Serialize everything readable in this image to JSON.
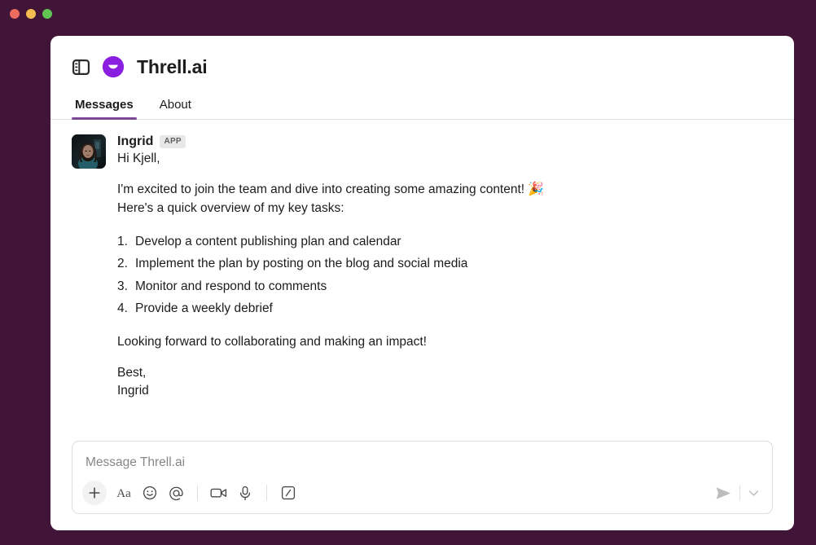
{
  "window": {
    "background_color": "#411538",
    "traffic_lights": [
      {
        "name": "close",
        "color": "#EC6A5E"
      },
      {
        "name": "minimize",
        "color": "#F4BD4F"
      },
      {
        "name": "maximize",
        "color": "#61C554"
      }
    ]
  },
  "header": {
    "sidebar_toggle_icon": "sidebar-toggle-icon",
    "app_icon": "threll-app-icon",
    "app_icon_color": "#8A1FE0",
    "title": "Threll.ai"
  },
  "tabs": {
    "active_index": 0,
    "active_underline_color": "#7C4799",
    "items": [
      {
        "label": "Messages",
        "active": true
      },
      {
        "label": "About",
        "active": false
      }
    ]
  },
  "message": {
    "avatar_alt": "Ingrid avatar photo",
    "author": "Ingrid",
    "badge": "APP",
    "badge_bg": "#E8E8E8",
    "greeting": "Hi Kjell,",
    "intro_line": "I'm excited to join the team and dive into creating some amazing content!",
    "intro_emoji": "🎉",
    "overview_line": "Here's a quick overview of my key tasks:",
    "tasks": [
      {
        "num": "1.",
        "text": "Develop a content publishing plan and calendar"
      },
      {
        "num": "2.",
        "text": "Implement the plan by posting on the blog and social media"
      },
      {
        "num": "3.",
        "text": "Monitor and respond to comments"
      },
      {
        "num": "4.",
        "text": "Provide a weekly debrief"
      }
    ],
    "closing_line": "Looking forward to collaborating and making an impact!",
    "signoff": "Best,",
    "signature": "Ingrid"
  },
  "composer": {
    "placeholder": "Message Threll.ai",
    "value": "",
    "toolbar": [
      {
        "name": "add-attachment-button",
        "icon": "plus-icon"
      },
      {
        "name": "formatting-button",
        "icon": "text-format-icon",
        "label": "Aa"
      },
      {
        "name": "emoji-button",
        "icon": "smiley-icon"
      },
      {
        "name": "mention-button",
        "icon": "at-mention-icon"
      },
      {
        "name": "video-clip-button",
        "icon": "video-camera-icon"
      },
      {
        "name": "audio-clip-button",
        "icon": "microphone-icon"
      },
      {
        "name": "slash-command-button",
        "icon": "slash-command-icon"
      }
    ],
    "send_icon": "send-plane-icon",
    "send_options_icon": "chevron-down-icon"
  }
}
